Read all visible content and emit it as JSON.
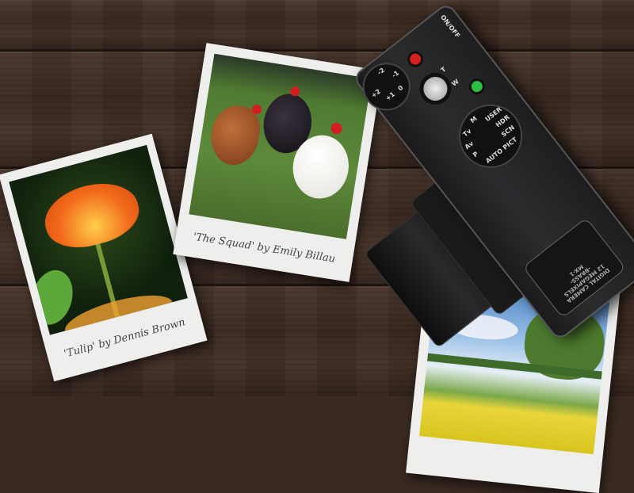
{
  "photos": [
    {
      "caption": "'Tulip' by Dennis Brown",
      "subject": "orange tulip"
    },
    {
      "caption": "'The Squad' by Emily Billau",
      "subject": "three chickens on grass"
    },
    {
      "caption": "",
      "subject": "yellow field with tree and cloudy sky"
    }
  ],
  "camera": {
    "power_label": "ON/OFF",
    "exposure_dial": [
      "+2",
      "+1",
      "0",
      "-1",
      "-2"
    ],
    "zoom_labels": [
      "T",
      "W"
    ],
    "mode_dial": [
      "M",
      "USER",
      "HDR",
      "SCN",
      "AUTO PICT",
      "P",
      "Av",
      "Tv"
    ],
    "badge": {
      "model": "MX-1",
      "megapixels": "12 MEGAPIXELS",
      "material": "-BRASS-",
      "type": "DIGITAL CAMERA"
    }
  },
  "colors": {
    "wood": "#3a2a22",
    "paper": "#eeeeec",
    "record": "#d42020",
    "play": "#2fbf45"
  }
}
